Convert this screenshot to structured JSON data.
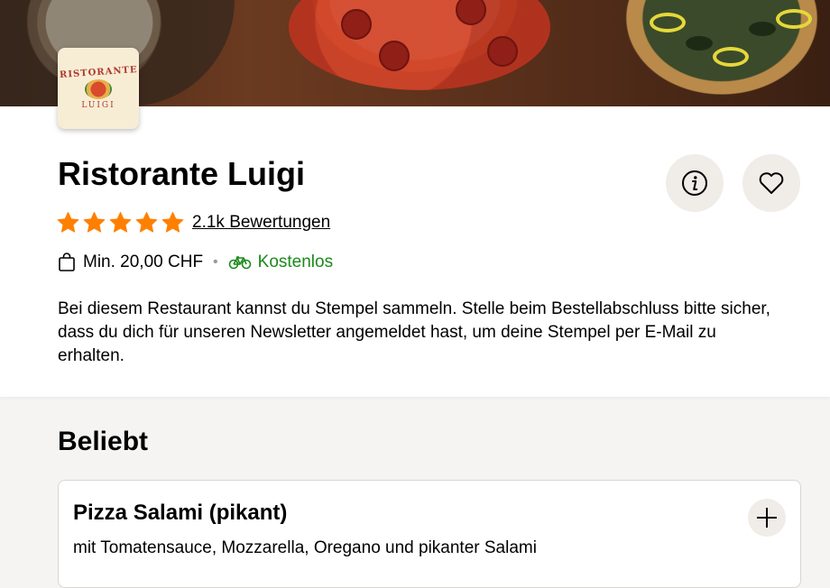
{
  "restaurant": {
    "name": "Ristorante Luigi",
    "logo": {
      "top": "RISTORANTE",
      "bottom": "LUIGI"
    },
    "rating_stars": 5,
    "reviews_label": "2.1k Bewertungen",
    "min_order": "Min. 20,00 CHF",
    "delivery": "Kostenlos",
    "description": "Bei diesem Restaurant kannst du Stempel sammeln. Stelle beim Bestellabschluss bitte sicher, dass du dich für unseren Newsletter angemeldet hast, um deine Stempel per E-Mail zu erhalten."
  },
  "icons": {
    "info": "info-icon",
    "favorite": "heart-icon",
    "bag": "bag-icon",
    "bike": "bike-icon",
    "add": "plus-icon"
  },
  "colors": {
    "star": "#ff8000",
    "delivery": "#1a8a1a"
  },
  "popular": {
    "title": "Beliebt",
    "items": [
      {
        "name": "Pizza Salami (pikant)",
        "description": "mit Tomatensauce, Mozzarella, Oregano und pikanter Salami"
      }
    ]
  }
}
